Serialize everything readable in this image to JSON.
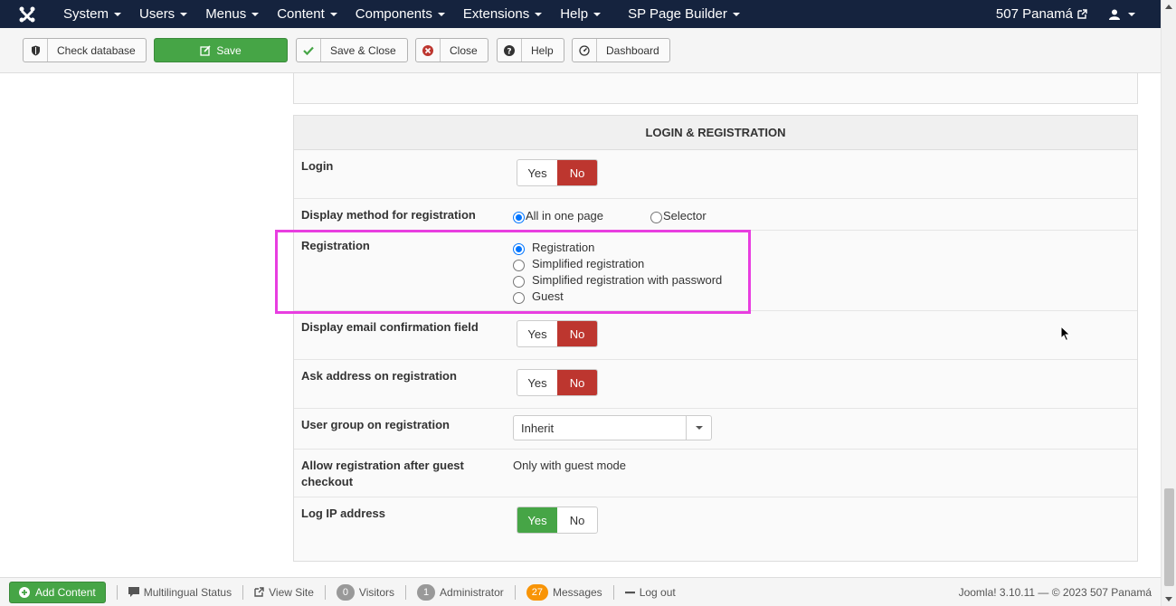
{
  "navbar": {
    "menu": [
      {
        "label": "System"
      },
      {
        "label": "Users"
      },
      {
        "label": "Menus"
      },
      {
        "label": "Content"
      },
      {
        "label": "Components"
      },
      {
        "label": "Extensions"
      },
      {
        "label": "Help"
      },
      {
        "label": "SP Page Builder"
      }
    ],
    "site_name": "507 Panamá"
  },
  "toolbar": {
    "check_database": "Check database",
    "save": "Save",
    "save_close": "Save & Close",
    "close": "Close",
    "help": "Help",
    "dashboard": "Dashboard"
  },
  "section": {
    "title": "LOGIN & REGISTRATION",
    "login": {
      "label": "Login",
      "yes": "Yes",
      "no": "No",
      "value": "No"
    },
    "display_method": {
      "label": "Display method for registration",
      "options": [
        "All in one page",
        "Selector"
      ],
      "selected": "All in one page"
    },
    "registration": {
      "label": "Registration",
      "options": [
        "Registration",
        "Simplified registration",
        "Simplified registration with password",
        "Guest"
      ],
      "selected": "Registration"
    },
    "email_confirm": {
      "label": "Display email confirmation field",
      "yes": "Yes",
      "no": "No",
      "value": "No"
    },
    "ask_address": {
      "label": "Ask address on registration",
      "yes": "Yes",
      "no": "No",
      "value": "No"
    },
    "user_group": {
      "label": "User group on registration",
      "value": "Inherit"
    },
    "allow_after_guest": {
      "label_line1": "Allow registration after guest",
      "label_line2": "checkout",
      "value": "Only with guest mode"
    },
    "log_ip": {
      "label": "Log IP address",
      "yes": "Yes",
      "no": "No",
      "value": "Yes"
    }
  },
  "statusbar": {
    "add_content": "Add Content",
    "multilingual": "Multilingual Status",
    "view_site": "View Site",
    "visitors_count": "0",
    "visitors_label": "Visitors",
    "admin_count": "1",
    "admin_label": "Administrator",
    "messages_count": "27",
    "messages_label": "Messages",
    "logout": "Log out",
    "copyright": "Joomla! 3.10.11  —  © 2023 507 Panamá"
  },
  "colors": {
    "navbar_bg": "#15233e",
    "save_green": "#46a546",
    "no_red": "#bd362f",
    "highlight": "#e83ee0",
    "badge_orange": "#f89406"
  }
}
